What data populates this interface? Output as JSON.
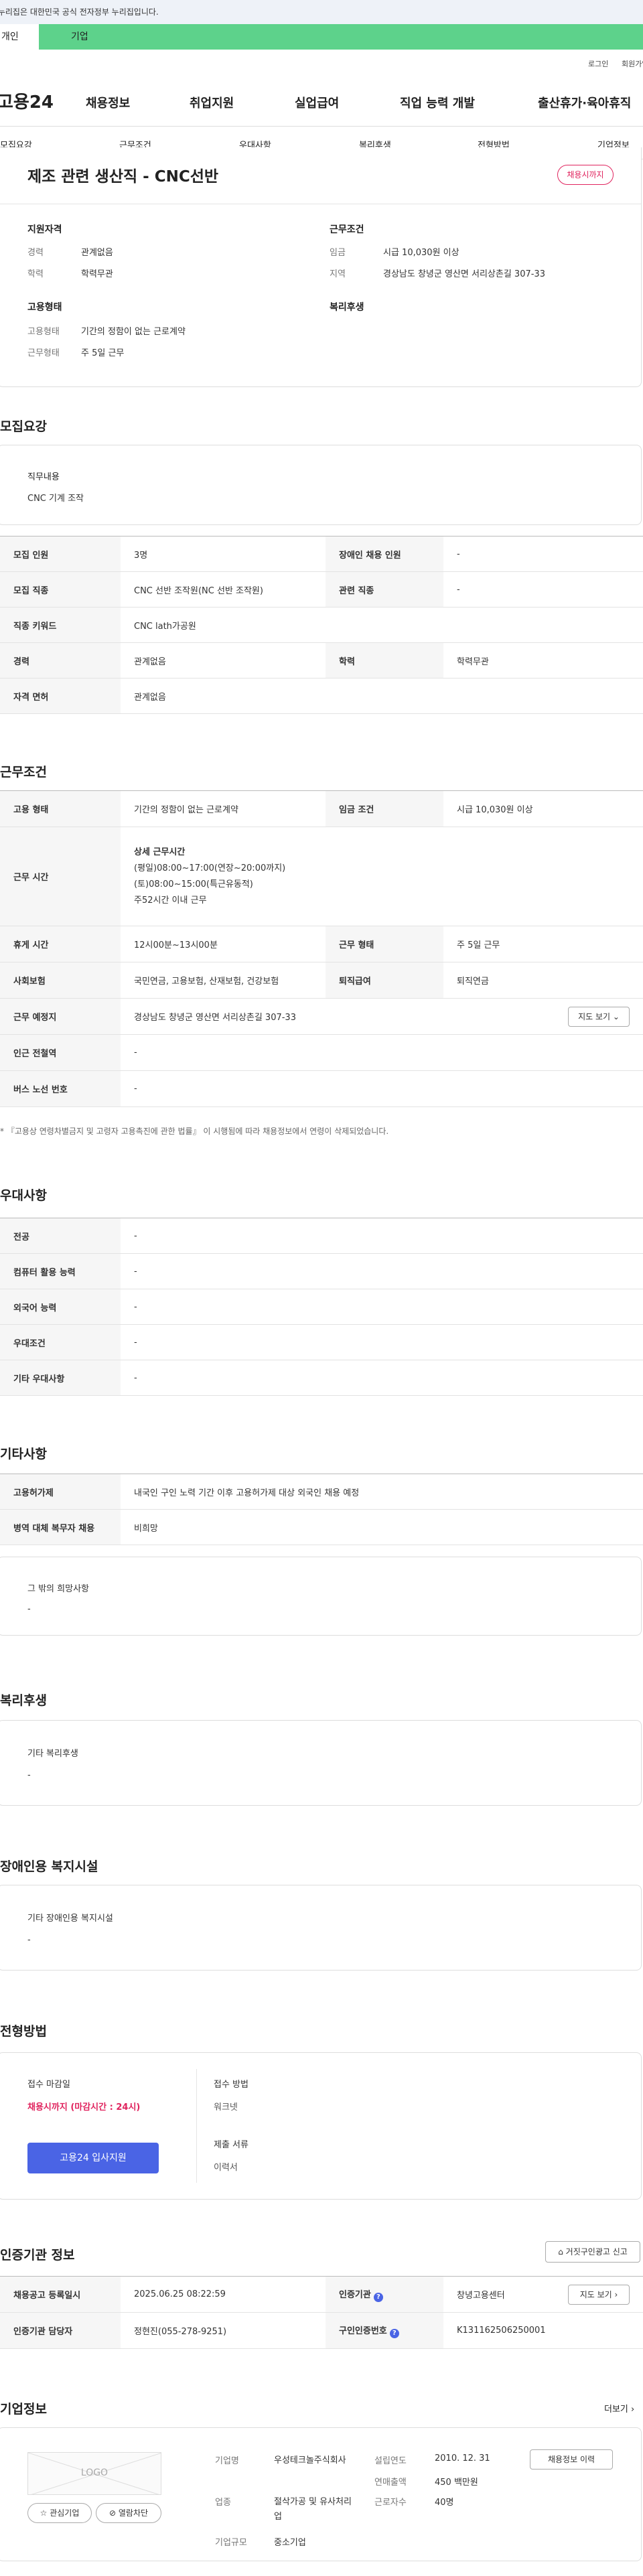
{
  "gov_banner": "이 누리집은 대한민국 공식 전자정부 누리집입니다.",
  "tabs": {
    "personal": "개인",
    "company": "기업"
  },
  "util": {
    "login": "로그인",
    "signup": "회원가입"
  },
  "gnb": {
    "logo": "고용24",
    "menu": [
      "채용정보",
      "취업지원",
      "실업급여",
      "직업 능력 개발",
      "출산휴가·육아휴직"
    ]
  },
  "subnav": [
    "모집요강",
    "근무조건",
    "우대사항",
    "복리후생",
    "전형방법",
    "기업정보"
  ],
  "job": {
    "title": "제조 관련 생산직 - CNC선반",
    "badge": "채용시까지",
    "qual_title": "지원자격",
    "qual": [
      {
        "k": "경력",
        "v": "관계없음"
      },
      {
        "k": "학력",
        "v": "학력무관"
      }
    ],
    "cond_title": "근무조건",
    "cond": [
      {
        "k": "임금",
        "v": "시급 10,030원 이상"
      },
      {
        "k": "지역",
        "v": "경상남도 창녕군 영산면 서리상촌길 307-33"
      }
    ],
    "emp_title": "고용형태",
    "emp": [
      {
        "k": "고용형태",
        "v": "기간의 정함이 없는 근로계약"
      },
      {
        "k": "근무형태",
        "v": "주 5일 근무"
      }
    ],
    "welfare_title": "복리후생"
  },
  "recruit": {
    "title": "모집요강",
    "duty_label": "직무내용",
    "duty_value": "CNC 기계 조작",
    "rows": [
      [
        "모집 인원",
        "3명",
        "장애인 채용 인원",
        "-"
      ],
      [
        "모집 직종",
        "CNC 선반 조작원(NC 선반 조작원)",
        "관련 직종",
        "-"
      ],
      [
        "직종 키워드",
        "CNC lath가공원"
      ],
      [
        "경력",
        "관계없음",
        "학력",
        "학력무관"
      ],
      [
        "자격 면허",
        "관계없음"
      ]
    ]
  },
  "work": {
    "title": "근무조건",
    "emp_type_k": "고용 형태",
    "emp_type_v": "기간의 정함이 없는 근로계약",
    "wage_k": "임금 조건",
    "wage_v": "시급 10,030원 이상",
    "hours_k": "근무 시간",
    "hours_head": "상세 근무시간",
    "hours_lines": [
      "(평일)08:00~17:00(연장~20:00까지)",
      "(토)08:00~15:00(특근유동적)",
      "주52시간 이내 근무"
    ],
    "rest_k": "휴게 시간",
    "rest_v": "12시00분~13시00분",
    "shift_k": "근무 형태",
    "shift_v": "주 5일 근무",
    "ins_k": "사회보험",
    "ins_v": "국민연금, 고용보험, 산재보험, 건강보험",
    "ret_k": "퇴직급여",
    "ret_v": "퇴직연금",
    "place_k": "근무 예정지",
    "place_v": "경상남도 창녕군 영산면 서리상촌길 307-33",
    "map_btn": "지도 보기",
    "station_k": "인근 전철역",
    "station_v": "-",
    "bus_k": "버스 노선 번호",
    "bus_v": "-",
    "note": "* 『고용상 연령차별금지 및 고령자 고용촉진에 관한 법률』 이 시행됨에 따라 채용정보에서 연령이 삭제되었습니다."
  },
  "pref": {
    "title": "우대사항",
    "rows": [
      [
        "전공",
        "-"
      ],
      [
        "컴퓨터 활용 능력",
        "-"
      ],
      [
        "외국어 능력",
        "-"
      ],
      [
        "우대조건",
        "-"
      ],
      [
        "기타 우대사항",
        "-"
      ]
    ]
  },
  "etc": {
    "title": "기타사항",
    "rows": [
      [
        "고용허가제",
        "내국인 구인 노력 기간 이후 고용허가제 대상 외국인 채용 예정"
      ],
      [
        "병역 대체 복무자 채용",
        "비희망"
      ]
    ],
    "other_label": "그 밖의 희망사항",
    "other_value": "-"
  },
  "benefit": {
    "title": "복리후생",
    "label": "기타 복리후생",
    "value": "-"
  },
  "disabled": {
    "title": "장애인용 복지시설",
    "label": "기타 장애인용 복지시설",
    "value": "-"
  },
  "selection": {
    "title": "전형방법",
    "deadline_label": "접수 마감일",
    "deadline_value": "채용시까지 (마감시간 : 24시)",
    "apply_btn": "고용24 입사지원",
    "method_label": "접수 방법",
    "method_value": "워크넷",
    "docs_label": "제출 서류",
    "docs_value": "이력서"
  },
  "cert": {
    "title": "인증기관 정보",
    "report_btn": "거짓구인광고 신고",
    "reg_k": "채용공고 등록일시",
    "reg_v": "2025.06.25 08:22:59",
    "org_k": "인증기관",
    "org_v": "창녕고용센터",
    "map_btn": "지도 보기",
    "mgr_k": "인증기관 담당자",
    "mgr_v": "정현진(055-278-9251)",
    "num_k": "구인인증번호",
    "num_v": "K131162506250001"
  },
  "company": {
    "title": "기업정보",
    "more": "더보기",
    "logo_text": "LOGO",
    "fav_btn": "관심기업",
    "block_btn": "열람차단",
    "name_k": "기업명",
    "name_v": "우성테크놀주식회사",
    "biz_k": "업종",
    "biz_v": "절삭가공 및 유사처리업",
    "size_k": "기업규모",
    "size_v": "중소기업",
    "est_k": "설립연도",
    "est_v": "2010. 12. 31",
    "sales_k": "연매출액",
    "sales_v": "450 백만원",
    "emp_k": "근로자수",
    "emp_v": "40명",
    "jobs_btn": "채용정보 이력"
  },
  "colors": {
    "green": "#5dd28b",
    "blue": "#4a64e5",
    "red": "#e0245e"
  }
}
